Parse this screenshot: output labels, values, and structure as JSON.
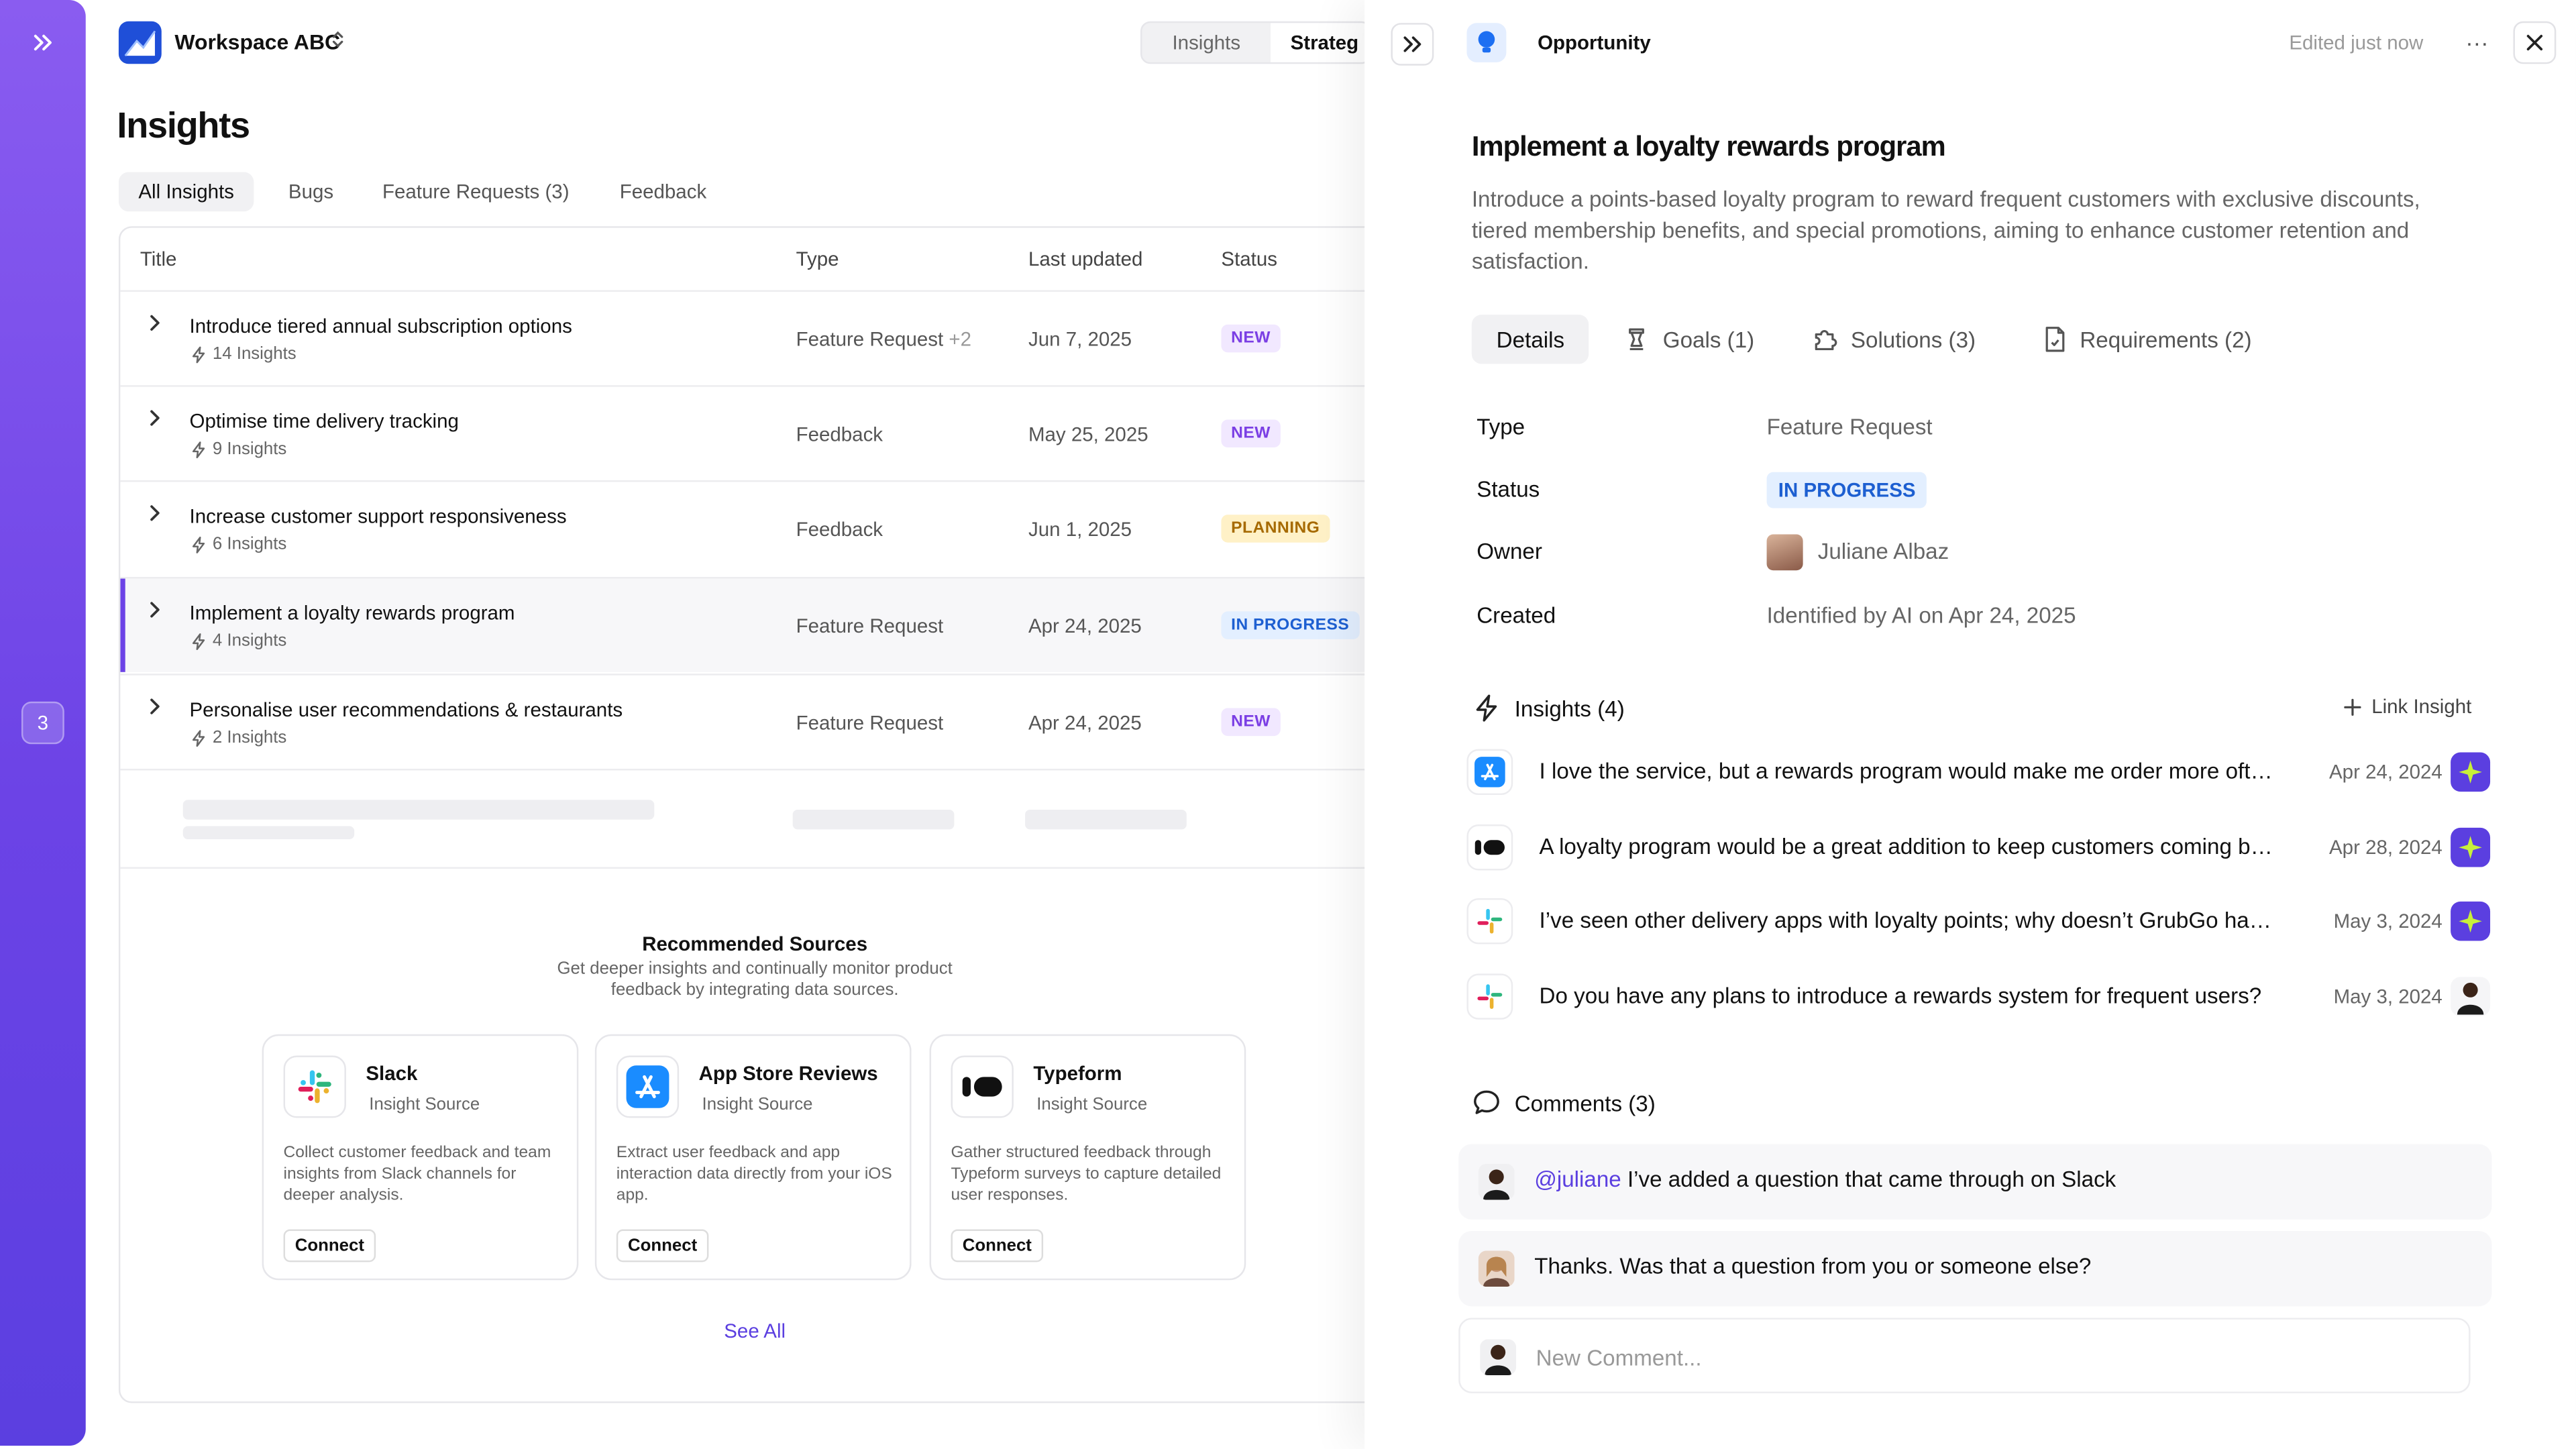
{
  "rail": {
    "badge": "3"
  },
  "workspace": {
    "name": "Workspace ABC",
    "switch_glyph": "⌃⌄"
  },
  "view_switch": {
    "insights": "Insights",
    "strategy": "Strateg"
  },
  "page": {
    "title": "Insights"
  },
  "filter_tabs": [
    "All Insights",
    "Bugs",
    "Feature Requests (3)",
    "Feedback"
  ],
  "table": {
    "headers": {
      "title": "Title",
      "type": "Type",
      "updated": "Last updated",
      "status": "Status"
    },
    "rows": [
      {
        "title": "Introduce tiered annual subscription options",
        "insights": "14 Insights",
        "type": "Feature Request",
        "type_more": "+2",
        "date": "Jun 7, 2025",
        "status": "NEW",
        "status_kind": "new"
      },
      {
        "title": "Optimise time delivery tracking",
        "insights": "9 Insights",
        "type": "Feedback",
        "type_more": "",
        "date": "May 25, 2025",
        "status": "NEW",
        "status_kind": "new"
      },
      {
        "title": "Increase customer support responsiveness",
        "insights": "6 Insights",
        "type": "Feedback",
        "type_more": "",
        "date": "Jun 1, 2025",
        "status": "PLANNING",
        "status_kind": "planning"
      },
      {
        "title": "Implement a loyalty rewards program",
        "insights": "4 Insights",
        "type": "Feature Request",
        "type_more": "",
        "date": "Apr 24, 2025",
        "status": "IN PROGRESS",
        "status_kind": "progress"
      },
      {
        "title": "Personalise user recommendations & restaurants",
        "insights": "2 Insights",
        "type": "Feature Request",
        "type_more": "",
        "date": "Apr 24, 2025",
        "status": "NEW",
        "status_kind": "new"
      }
    ]
  },
  "recommended": {
    "title": "Recommended Sources",
    "subtitle": "Get deeper insights and continually monitor product feedback by integrating data sources.",
    "cards": [
      {
        "name": "Slack",
        "kind": "Insight Source",
        "desc": "Collect customer feedback and team insights from Slack channels for deeper analysis.",
        "button": "Connect",
        "icon": "slack-icon"
      },
      {
        "name": "App Store Reviews",
        "kind": "Insight Source",
        "desc": "Extract user feedback and app interaction data directly from your iOS app.",
        "button": "Connect",
        "icon": "app-store-icon"
      },
      {
        "name": "Typeform",
        "kind": "Insight Source",
        "desc": "Gather structured feedback through Typeform surveys to capture detailed user responses.",
        "button": "Connect",
        "icon": "typeform-icon"
      }
    ],
    "see_all": "See All"
  },
  "drawer": {
    "kind": "Opportunity",
    "edited": "Edited just now",
    "more": "···",
    "title": "Implement a loyalty rewards program",
    "description": "Introduce a points-based loyalty program to reward frequent customers with exclusive discounts, tiered membership benefits, and special promotions, aiming to enhance customer retention and satisfaction.",
    "tabs": [
      "Details",
      "Goals (1)",
      "Solutions (3)",
      "Requirements (2)"
    ],
    "props": {
      "type_label": "Type",
      "type_value": "Feature Request",
      "status_label": "Status",
      "status_value": "IN PROGRESS",
      "owner_label": "Owner",
      "owner_value": "Juliane Albaz",
      "created_label": "Created",
      "created_value": "Identified by AI on Apr 24, 2025"
    },
    "insights": {
      "heading": "Insights (4)",
      "link_label": "Link Insight",
      "items": [
        {
          "source": "app-store-icon",
          "text": "I love the service, but a rewards program would make me order more often!",
          "date": "Apr 24, 2024",
          "avatar": "ai-sparkle-icon"
        },
        {
          "source": "typeform-icon",
          "text": "A loyalty program would be a great addition to keep customers coming back.",
          "date": "Apr 28, 2024",
          "avatar": "ai-sparkle-icon"
        },
        {
          "source": "slack-icon",
          "text": "I’ve seen other delivery apps with loyalty points; why doesn’t GrubGo have one?",
          "date": "May 3, 2024",
          "avatar": "ai-sparkle-icon"
        },
        {
          "source": "slack-icon",
          "text": "Do you have any plans to introduce a rewards system for frequent users?",
          "date": "May 3, 2024",
          "avatar": "user-avatar"
        }
      ]
    },
    "comments": {
      "heading": "Comments (3)",
      "items": [
        {
          "mention": "@juliane",
          "text": " I’ve added a question that came through on Slack"
        },
        {
          "mention": "",
          "text": "Thanks. Was that a question from you or someone else?"
        }
      ],
      "placeholder": "New Comment..."
    }
  }
}
